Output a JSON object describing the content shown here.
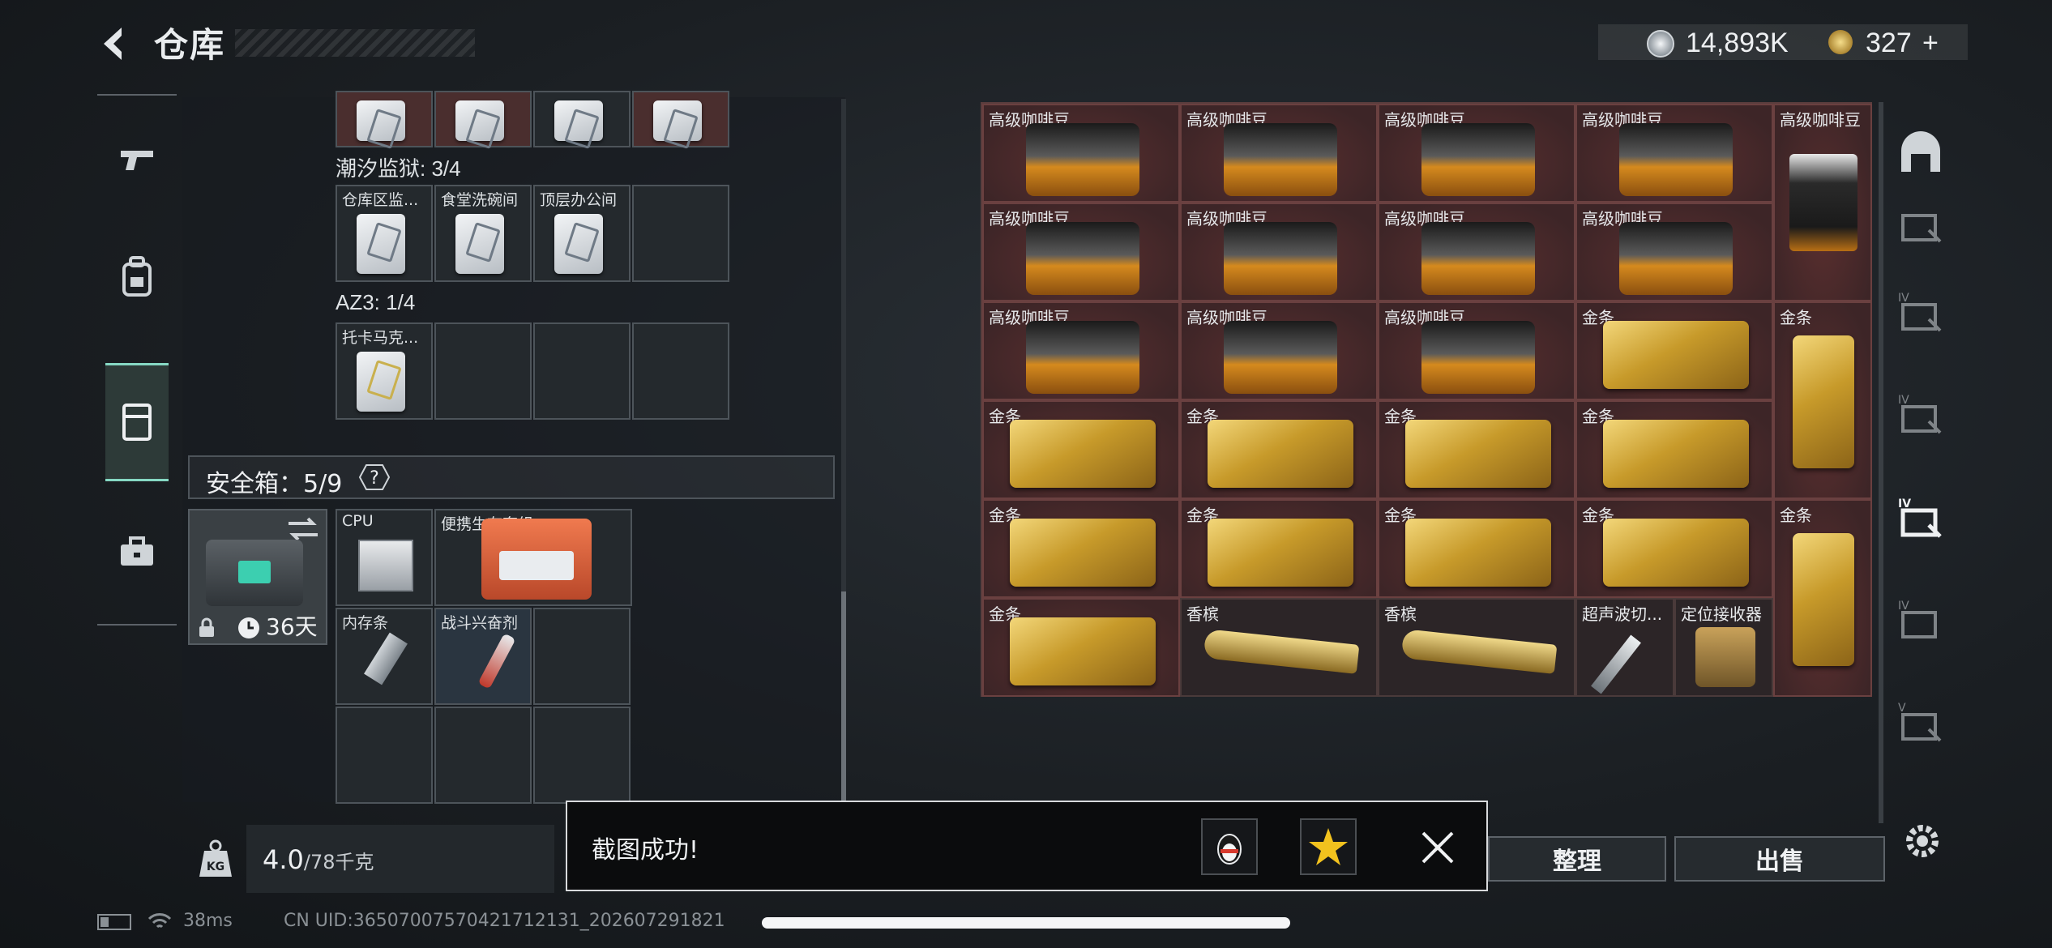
{
  "header": {
    "title": "仓库"
  },
  "currency": {
    "coins": "14,893K",
    "tokens": "327",
    "tokens_plus": "+"
  },
  "left_nav": {
    "items": [
      "weapons-tab",
      "gear-tab",
      "storage-tab",
      "case-tab"
    ],
    "active": "storage-tab"
  },
  "stash": {
    "groups": [
      {
        "label": "潮汐监狱: 3/4",
        "slots": [
          "仓库区监...",
          "食堂洗碗间",
          "顶层办公间",
          ""
        ]
      },
      {
        "label": "AZ3: 1/4",
        "slots": [
          "托卡马克...",
          "",
          "",
          ""
        ]
      }
    ]
  },
  "safe_box": {
    "title": "安全箱：5/9",
    "help": "?",
    "days_left": "36天",
    "items": [
      {
        "label": "CPU"
      },
      {
        "label": "便携生存套组"
      },
      {
        "label": "内存条"
      },
      {
        "label": "战斗兴奋剂"
      }
    ]
  },
  "weight": {
    "icon": "KG",
    "current": "4.0",
    "max": "/78千克"
  },
  "container": {
    "coffee_label": "高级咖啡豆",
    "gold_label": "金条",
    "items": [
      {
        "label": "高级咖啡豆"
      },
      {
        "label": "高级咖啡豆"
      },
      {
        "label": "高级咖啡豆"
      },
      {
        "label": "高级咖啡豆"
      },
      {
        "label": "高级咖啡豆"
      },
      {
        "label": "高级咖啡豆"
      },
      {
        "label": "高级咖啡豆"
      },
      {
        "label": "高级咖啡豆"
      },
      {
        "label": "高级咖啡豆"
      },
      {
        "label": "高级咖啡豆"
      },
      {
        "label": "高级咖啡豆"
      },
      {
        "label": "高级咖啡豆"
      },
      {
        "label": "金条"
      },
      {
        "label": "金条"
      },
      {
        "label": "金条"
      },
      {
        "label": "金条"
      },
      {
        "label": "金条"
      },
      {
        "label": "金条"
      },
      {
        "label": "金条"
      },
      {
        "label": "金条"
      },
      {
        "label": "金条"
      },
      {
        "label": "金条"
      },
      {
        "label": "金条"
      },
      {
        "label": "金条"
      },
      {
        "label": "香槟"
      },
      {
        "label": "香槟"
      },
      {
        "label": "超声波切..."
      },
      {
        "label": "定位接收器"
      }
    ]
  },
  "actions": {
    "organize": "整理",
    "sell": "出售"
  },
  "toast": {
    "message": "截图成功!"
  },
  "status_bar": {
    "ping": "38ms",
    "uid": "CN UID:3650700757042171213​1_202607291821"
  }
}
